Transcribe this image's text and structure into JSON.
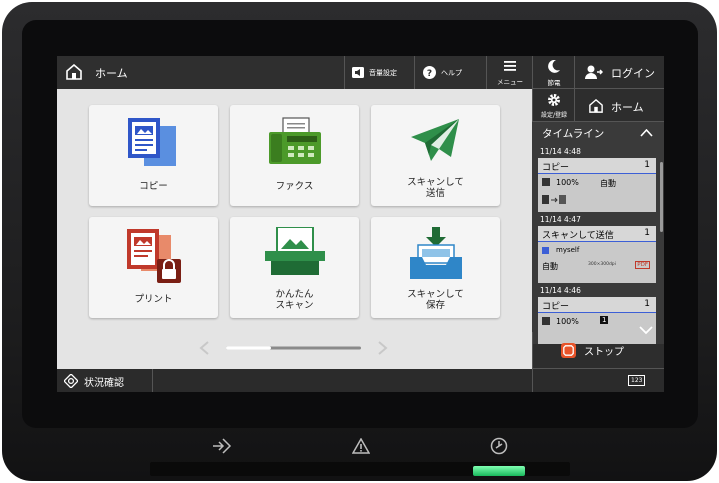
{
  "header": {
    "title": "ホーム",
    "volume_label": "音量設定",
    "help_label": "ヘルプ",
    "menu_label": "メニュー"
  },
  "right": {
    "sleep_label": "節電",
    "login_label": "ログイン",
    "settings_label": "設定/登録",
    "home_label": "ホーム",
    "stop_label": "ストップ"
  },
  "tiles": [
    {
      "label": "コピー"
    },
    {
      "label": "ファクス"
    },
    {
      "label": "スキャンして\n送信"
    },
    {
      "label": "プリント"
    },
    {
      "label": "かんたん\nスキャン"
    },
    {
      "label": "スキャンして\n保存"
    }
  ],
  "pager": {
    "current_page": 1,
    "page_count": 3
  },
  "status": {
    "label": "状況確認",
    "keypad_label": "123"
  },
  "timeline": {
    "title": "タイムライン",
    "jobs": [
      {
        "time": "11/14 4:48",
        "name": "コピー",
        "count": "1",
        "zoom": "100%",
        "mode": "自動"
      },
      {
        "time": "11/14 4:47",
        "name": "スキャンして送信",
        "count": "1",
        "dest": "myself",
        "mode": "自動",
        "res": "300×300dpi",
        "fmt": "PDF"
      },
      {
        "time": "11/14 4:46",
        "name": "コピー",
        "count": "1",
        "zoom": "100%",
        "copies": "1"
      }
    ]
  },
  "colors": {
    "fax_green": "#4c9a2a",
    "send_green": "#2f8f4a",
    "copy_blue": "#2f56c8",
    "print_red": "#c0392b",
    "save_blue": "#2f86c8",
    "stop_red": "#e8542a",
    "power_led": "#3ddc84"
  }
}
